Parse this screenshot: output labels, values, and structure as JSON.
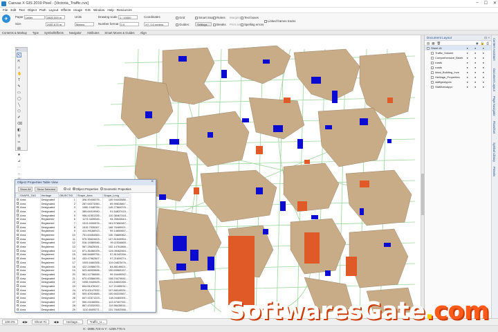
{
  "window": {
    "title": "Canvas X GIS 2019 Pixel - [Victoria_Traffic.cvx]",
    "controls": [
      "–",
      "☐",
      "✕"
    ]
  },
  "menu": [
    "File",
    "Edit",
    "Text",
    "Object",
    "Path",
    "Layout",
    "Effects",
    "Image",
    "GIS",
    "Window",
    "Help",
    "Resources"
  ],
  "ribbon": {
    "paper_label": "Paper",
    "paper_value": "Letter",
    "size_label": "Size",
    "size_value": "2800.000 m",
    "size_value2": "2987.675 m",
    "units_label": "Units",
    "units_value": "Meters",
    "scale_value": "1 : 10000",
    "drawing_scale_label": "Drawing scale",
    "drawing_scale_value": "1 : 10000.0",
    "number_format_label": "Number format",
    "number_format_value": "0.0",
    "coordinates_label": "Coordinates",
    "coordinates_value": "XY: 0.0 meters",
    "grid_label": "Grid",
    "guides_label": "Guides",
    "smart_snaps_label": "Smart Snaps",
    "rulers_label": "Rulers",
    "text_boxes_label": "Text boxes",
    "settings_label": "Settings...",
    "breaks_label": "Breaks",
    "print_area_label": "Print area",
    "spelling_label": "Spelling errors",
    "margins_label": "Margins",
    "linked_frames_label": "Linked frames tracks"
  },
  "panel_tabs": [
    "Contents & Markup",
    "Type",
    "Symbol/Effects",
    "Navigator",
    "Attributes",
    "Smart Moves & Guides",
    "Align"
  ],
  "object_table": {
    "title": "Object Properties Table View",
    "show_all": "Show All",
    "show_selected": "Show Selected",
    "radio_all": "All",
    "radio_object": "Object Properties",
    "radio_geometry": "Geometric Properties",
    "columns": [
      "SHAPE_TAG",
      "Heritage",
      "OBJECTID",
      "Shape_Area",
      "Shape_Leng"
    ],
    "rows": [
      [
        "Area",
        "Designated",
        "1",
        "306.49408376...",
        "100.94443586..."
      ],
      [
        "Area",
        "Designated",
        "2",
        "287.64073350...",
        "69.99815867..."
      ],
      [
        "Area",
        "Designated",
        "3",
        "1080.1046784...",
        "145.27684376..."
      ],
      [
        "Area",
        "Designated",
        "4",
        "385.64019940...",
        "91.54837415..."
      ],
      [
        "Area",
        "Designated",
        "5",
        "956.41551335...",
        "110.38467318..."
      ],
      [
        "Area",
        "Registered",
        "6",
        "1173.3426545...",
        "94.25543544..."
      ],
      [
        "Area",
        "Registered",
        "7",
        "1513.9490876...",
        "161.97650087..."
      ],
      [
        "Area",
        "Designated",
        "8",
        "1515.7935367...",
        "166.76489921..."
      ],
      [
        "Area",
        "Registered",
        "9",
        "411.99168913...",
        "99.14650657..."
      ],
      [
        "Area",
        "Registered",
        "10",
        "751.63054563...",
        "130.76689362..."
      ],
      [
        "Area",
        "Registered",
        "11",
        "575.35624403...",
        "107.81949954..."
      ],
      [
        "Area",
        "Designated",
        "12",
        "516.14580546...",
        "99.11534665..."
      ],
      [
        "Area",
        "Registered",
        "13",
        "567.28625091...",
        "102.14761866..."
      ],
      [
        "Area",
        "Designated",
        "14",
        "871.36468109...",
        "124.08462064..."
      ],
      [
        "Area",
        "Registered",
        "15",
        "446.84659794...",
        "97.81342266..."
      ],
      [
        "Area",
        "Registered",
        "16",
        "433.47962807...",
        "97.21609274..."
      ],
      [
        "Area",
        "Registered",
        "17",
        "1005.5460306...",
        "119.04823476..."
      ],
      [
        "Area",
        "Registered",
        "18",
        "422.24986075...",
        "84.88146621..."
      ],
      [
        "Area",
        "Registered",
        "19",
        "523.46009896...",
        "100.65983157..."
      ],
      [
        "Area",
        "Designated",
        "20",
        "561.12756848...",
        "99.16449052..."
      ],
      [
        "Area",
        "Designated",
        "21",
        "670.43566095...",
        "108.23479541..."
      ],
      [
        "Area",
        "Designated",
        "22",
        "1098.9440625...",
        "131.84602266..."
      ],
      [
        "Area",
        "Designated",
        "23",
        "844.81478167...",
        "117.21488011..."
      ],
      [
        "Area",
        "Designated",
        "24",
        "674.43147632...",
        "107.88244531..."
      ],
      [
        "Area",
        "Designated",
        "25",
        "509.40924685...",
        "100.66310667..."
      ],
      [
        "Area",
        "Designated",
        "26",
        "847.41671223...",
        "118.04483391..."
      ],
      [
        "Area",
        "Designated",
        "27",
        "599.43166954...",
        "113.07467911..."
      ],
      [
        "Area",
        "Designated",
        "28",
        "867.43332053...",
        "119.56438011..."
      ],
      [
        "Area",
        "Designated",
        "29",
        "1110.8409271...",
        "131.78402066..."
      ]
    ]
  },
  "layers_panel": {
    "title": "Document Layout",
    "items": [
      {
        "label": "Sheet #1",
        "indent": 0
      },
      {
        "label": "Traffic_Volume",
        "indent": 1
      },
      {
        "label": "Comprehensive_Bikeb",
        "indent": 1
      },
      {
        "label": "roads",
        "indent": 1
      },
      {
        "label": "roads",
        "indent": 1
      },
      {
        "label": "Ideal_Building_Inve",
        "indent": 1
      },
      {
        "label": "Heritage_Properties",
        "indent": 1
      },
      {
        "label": "staffgeotypes",
        "indent": 1
      },
      {
        "label": "StaffAreaAppr",
        "indent": 1
      }
    ]
  },
  "side_tabs": [
    "Content Assistant",
    "Document Layout",
    "Page Navigator",
    "Flowchart",
    "Symbol Library",
    "Presets"
  ],
  "status": {
    "zoom": "100.0%",
    "sheet": "Sheet #1",
    "layer_tab1": "Heritage...",
    "layer_tab2": "Traffic_U...",
    "coords": "X: -2885.723 m  Y: -1259.775 m"
  },
  "watermark": {
    "part1": "SoftwaresGate",
    "dot": ".",
    "part2": "com"
  },
  "colors": {
    "parcel": "#c8ac88",
    "heritage": "#0a0ad0",
    "traffic": "#e05a28",
    "roads": "#7ec87e",
    "toolbar_bg": "#f7f7f7",
    "accent": "#2c8ed6"
  }
}
